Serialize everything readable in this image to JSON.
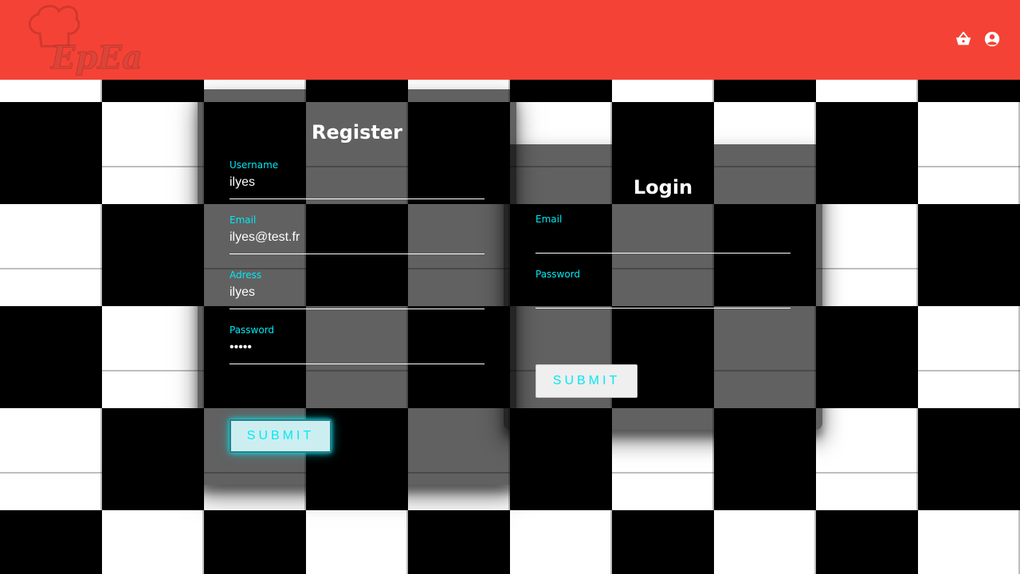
{
  "header": {
    "logo_text": "EpEat",
    "brand_color": "#f44336",
    "icons": [
      "basket-icon",
      "account-circle-icon"
    ]
  },
  "register": {
    "title": "Register",
    "fields": [
      {
        "label": "Username",
        "value": "ilyes"
      },
      {
        "label": "Email",
        "value": "ilyes@test.fr"
      },
      {
        "label": "Adress",
        "value": "ilyes"
      },
      {
        "label": "Password",
        "value": "•••••"
      }
    ],
    "submit_label": "SUBMIT"
  },
  "login": {
    "title": "Login",
    "fields": [
      {
        "label": "Email",
        "value": ""
      },
      {
        "label": "Password",
        "value": ""
      }
    ],
    "submit_label": "SUBMIT"
  },
  "colors": {
    "accent": "#03e9f4",
    "header": "#f44336"
  }
}
